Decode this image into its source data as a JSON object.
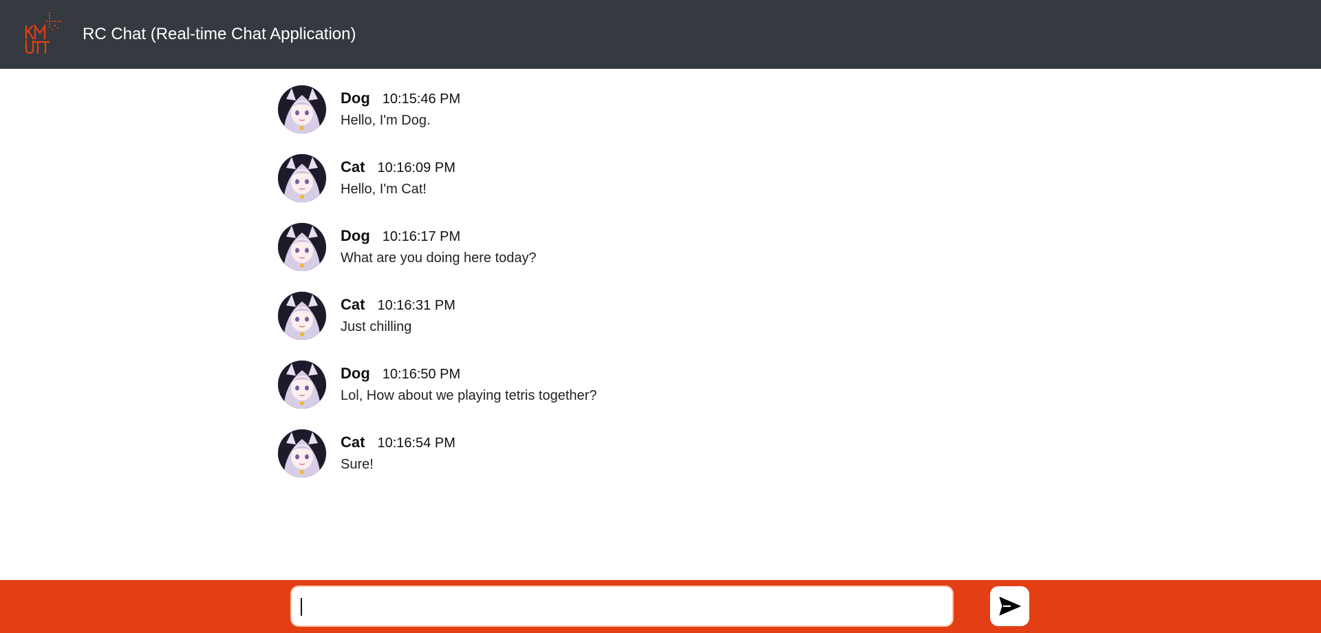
{
  "header": {
    "logo_text": "KMUTT",
    "title": "RC Chat (Real-time Chat Application)"
  },
  "messages": [
    {
      "sender": "Dog",
      "time": "10:15:46 PM",
      "text": "Hello, I'm Dog."
    },
    {
      "sender": "Cat",
      "time": "10:16:09 PM",
      "text": "Hello, I'm Cat!"
    },
    {
      "sender": "Dog",
      "time": "10:16:17 PM",
      "text": "What are you doing here today?"
    },
    {
      "sender": "Cat",
      "time": "10:16:31 PM",
      "text": "Just chilling"
    },
    {
      "sender": "Dog",
      "time": "10:16:50 PM",
      "text": "Lol, How about we playing tetris together?"
    },
    {
      "sender": "Cat",
      "time": "10:16:54 PM",
      "text": "Sure!"
    }
  ],
  "composer": {
    "value": "",
    "placeholder": "",
    "send_icon": "send-icon"
  },
  "colors": {
    "header_bg": "#343a40",
    "footer_bg": "#e43f14",
    "logo_accent": "#e43f14"
  }
}
